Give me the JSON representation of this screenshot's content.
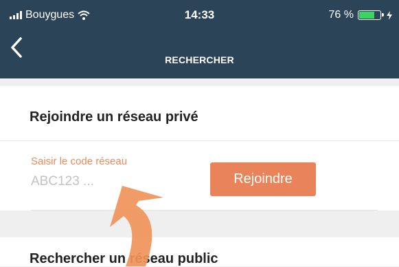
{
  "status_bar": {
    "carrier": "Bouygues",
    "time": "14:33",
    "battery": "76 %",
    "battery_level": 0.76
  },
  "nav": {
    "title": "RECHERCHER"
  },
  "private_network": {
    "title": "Rejoindre un réseau privé",
    "field_label": "Saisir le code réseau",
    "field_placeholder": "ABC123 ...",
    "field_value": "",
    "join_label": "Rejoindre"
  },
  "public_network": {
    "title": "Rechercher un réseau public"
  },
  "colors": {
    "header_bg": "#2c4457",
    "accent": "#e9845a",
    "arrow": "#f0935a"
  },
  "icons": {
    "back": "chevron-left-icon",
    "wifi": "wifi-icon",
    "signal": "signal-icon",
    "battery": "battery-icon",
    "charging": "bolt-icon",
    "annotation": "curved-arrow-icon"
  }
}
